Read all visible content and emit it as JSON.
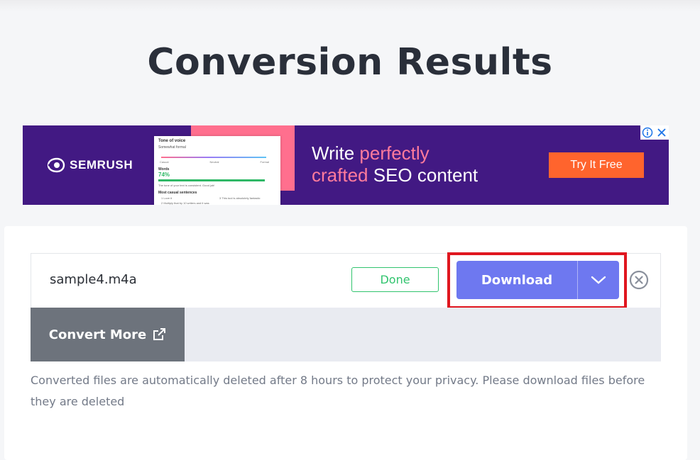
{
  "page": {
    "title": "Conversion Results"
  },
  "ad": {
    "brand": "SEMRUSH",
    "headline_part1": "Write ",
    "headline_highlight1": "perfectly",
    "headline_highlight2": "crafted",
    "headline_part2": " SEO content",
    "cta_label": "Try It Free",
    "card": {
      "title": "Tone of voice",
      "subtitle": "Somewhat formal",
      "scale_left": "Casual",
      "scale_mid": "Neutral",
      "scale_right": "Formal",
      "metric_label": "Words",
      "metric_value": "74%",
      "metric_note": "The tone of your text is consistent. Good job!",
      "list_title": "Most casual sentences",
      "item1": "1 Love it",
      "item2": "3 This tool is absolutely fantastic",
      "item3": "2 Multiply that by 10 writers and it was",
      "item4": "Show more"
    },
    "colors": {
      "background": "#421983",
      "highlight": "#ff7b9c",
      "cta": "#ff642d"
    },
    "icons": [
      "ad-info-icon",
      "ad-close-icon"
    ]
  },
  "file": {
    "name": "sample4.m4a",
    "status": "Done",
    "download_label": "Download"
  },
  "actions": {
    "convert_more_label": "Convert More"
  },
  "notice": {
    "text": "Converted files are automatically deleted after 8 hours to protect your privacy. Please download files before they are deleted"
  },
  "colors": {
    "download": "#6e78f0",
    "status": "#31c46e",
    "convert_more": "#6d737c",
    "highlight_frame": "#e0161f"
  }
}
